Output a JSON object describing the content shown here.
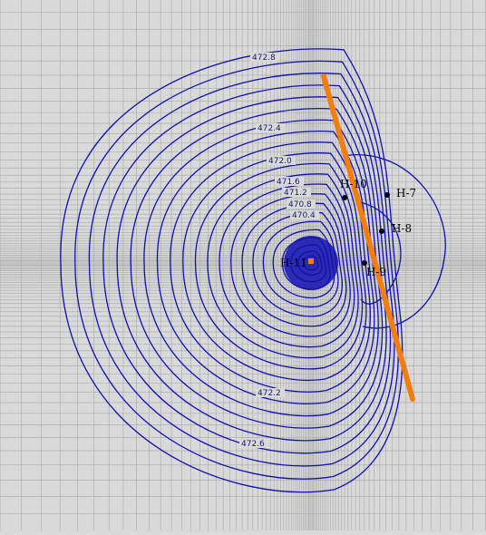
{
  "colors": {
    "background": "#d9d9d9",
    "grid": "#a8a8a8",
    "contour": "#1010b0",
    "barrier": "#f07f10",
    "well": "#000000",
    "pumping_well": "#f07f10"
  },
  "contour_labels": [
    "472.8",
    "472.4",
    "472.0",
    "471.6",
    "471.2",
    "470.8",
    "470.4",
    "472.2",
    "472.6"
  ],
  "wells": [
    {
      "id": "H-7",
      "label": "H-7"
    },
    {
      "id": "H-8",
      "label": "H-8"
    },
    {
      "id": "H-9",
      "label": "H-9"
    },
    {
      "id": "H-10",
      "label": "H-10"
    },
    {
      "id": "H-11",
      "label": "H-11"
    }
  ],
  "pumping_well_label": "H-11"
}
